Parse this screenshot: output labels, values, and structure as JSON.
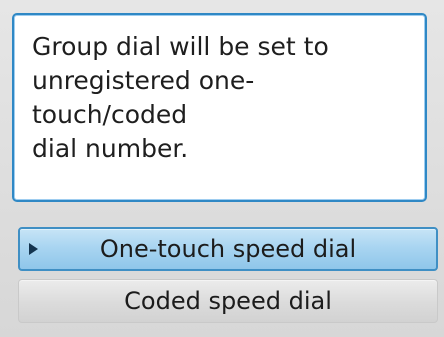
{
  "message": {
    "text": "Group dial will be set to\nunregistered one-touch/coded\ndial number."
  },
  "options": [
    {
      "label": "One-touch speed dial",
      "selected": true
    },
    {
      "label": "Coded speed dial",
      "selected": false
    }
  ],
  "icons": {
    "selection_cursor": "triangle-right-icon"
  },
  "colors": {
    "accent": "#2f88c5",
    "selected_bg": "#a9d5f1",
    "option_bg": "#dbdbdb",
    "screen_bg": "#d9d9d9"
  }
}
